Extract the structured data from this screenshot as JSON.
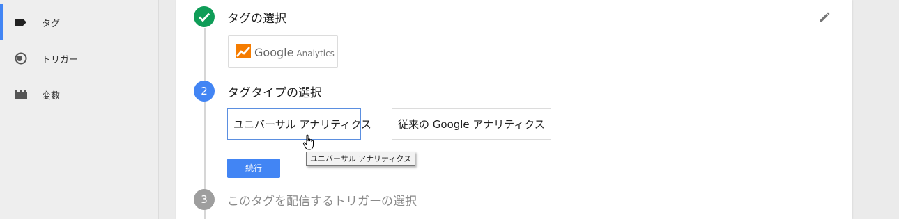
{
  "sidebar": {
    "items": [
      {
        "label": "タグ",
        "icon": "tag-icon",
        "active": true
      },
      {
        "label": "トリガー",
        "icon": "trigger-icon",
        "active": false
      },
      {
        "label": "変数",
        "icon": "variables-icon",
        "active": false
      }
    ]
  },
  "steps": {
    "step1": {
      "title": "タグの選択",
      "status": "completed"
    },
    "step2": {
      "number": "2",
      "title": "タグタイプの選択",
      "status": "active"
    },
    "step3": {
      "number": "3",
      "title": "このタグを配信するトリガーの選択",
      "status": "pending"
    }
  },
  "product": {
    "name": "Google",
    "sub": "Analytics"
  },
  "tag_types": {
    "universal": "ユニバーサル アナリティクス",
    "classic": "従来の Google アナリティクス"
  },
  "continue_label": "続行",
  "tooltip": "ユニバーサル アナリティクス",
  "colors": {
    "accent": "#4285f4",
    "success": "#0f9d58",
    "muted": "#9e9e9e"
  }
}
